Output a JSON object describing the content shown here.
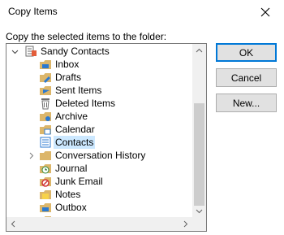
{
  "window": {
    "title": "Copy Items"
  },
  "dialog": {
    "label": "Copy the selected items to the folder:"
  },
  "tree": {
    "root": "Sandy Contacts",
    "items": [
      {
        "label": "Inbox",
        "icon": "inbox-folder-icon"
      },
      {
        "label": "Drafts",
        "icon": "drafts-folder-icon"
      },
      {
        "label": "Sent Items",
        "icon": "sent-folder-icon"
      },
      {
        "label": "Deleted Items",
        "icon": "trash-icon"
      },
      {
        "label": "Archive",
        "icon": "archive-folder-icon"
      },
      {
        "label": "Calendar",
        "icon": "calendar-folder-icon"
      },
      {
        "label": "Contacts",
        "icon": "contacts-folder-icon",
        "selected": true
      },
      {
        "label": "Conversation History",
        "icon": "conversation-folder-icon",
        "expandable": true
      },
      {
        "label": "Journal",
        "icon": "journal-folder-icon"
      },
      {
        "label": "Junk Email",
        "icon": "junk-folder-icon"
      },
      {
        "label": "Notes",
        "icon": "notes-folder-icon"
      },
      {
        "label": "Outbox",
        "icon": "outbox-folder-icon"
      }
    ]
  },
  "buttons": {
    "ok": "OK",
    "cancel": "Cancel",
    "new": "New..."
  },
  "colors": {
    "selection": "#cce8ff",
    "default_button_border": "#0078d7",
    "folder": "#dcb66a"
  }
}
